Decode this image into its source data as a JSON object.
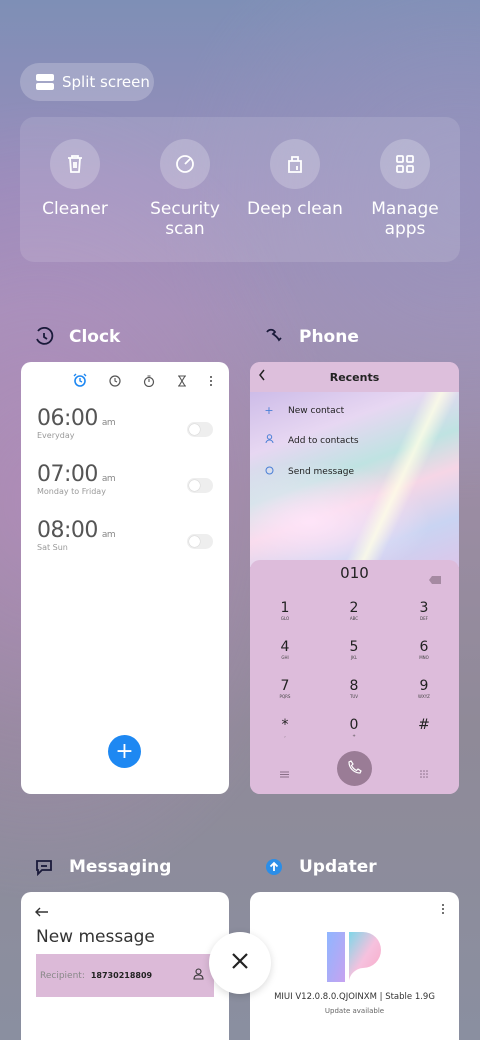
{
  "split_screen": {
    "label": "Split screen",
    "icon": "split-screen-icon"
  },
  "tools": [
    {
      "label": "Cleaner",
      "icon": "trash-icon"
    },
    {
      "label": "Security\nscan",
      "icon": "security-scan-icon"
    },
    {
      "label": "Deep clean",
      "icon": "deep-clean-icon"
    },
    {
      "label": "Manage\napps",
      "icon": "grid-icon"
    }
  ],
  "clock_app": {
    "name": "Clock",
    "alarms": [
      {
        "time": "06:00",
        "ampm": "am",
        "repeat": "Everyday"
      },
      {
        "time": "07:00",
        "ampm": "am",
        "repeat": "Monday to Friday"
      },
      {
        "time": "08:00",
        "ampm": "am",
        "repeat": "Sat Sun"
      }
    ],
    "fab": "+"
  },
  "phone_app": {
    "name": "Phone",
    "title": "Recents",
    "options": [
      "New contact",
      "Add to contacts",
      "Send message"
    ],
    "dialed": "010",
    "keys": [
      {
        "digit": "1",
        "letters": "GLO"
      },
      {
        "digit": "2",
        "letters": "ABC"
      },
      {
        "digit": "3",
        "letters": "DEF"
      },
      {
        "digit": "4",
        "letters": "GHI"
      },
      {
        "digit": "5",
        "letters": "JKL"
      },
      {
        "digit": "6",
        "letters": "MNO"
      },
      {
        "digit": "7",
        "letters": "PQRS"
      },
      {
        "digit": "8",
        "letters": "TUV"
      },
      {
        "digit": "9",
        "letters": "WXYZ"
      },
      {
        "digit": "*",
        "letters": ","
      },
      {
        "digit": "0",
        "letters": "+"
      },
      {
        "digit": "#",
        "letters": ""
      }
    ]
  },
  "messaging_app": {
    "name": "Messaging",
    "title": "New message",
    "recipient_label": "Recipient:",
    "recipient_value": "18730218809"
  },
  "updater_app": {
    "name": "Updater",
    "version": "MIUI V12.0.8.0.QJOINXM | Stable 1.9G",
    "status": "Update available"
  },
  "colors": {
    "accent_blue": "#1e88f2",
    "dialpad_pink": "#ddbcdb"
  }
}
